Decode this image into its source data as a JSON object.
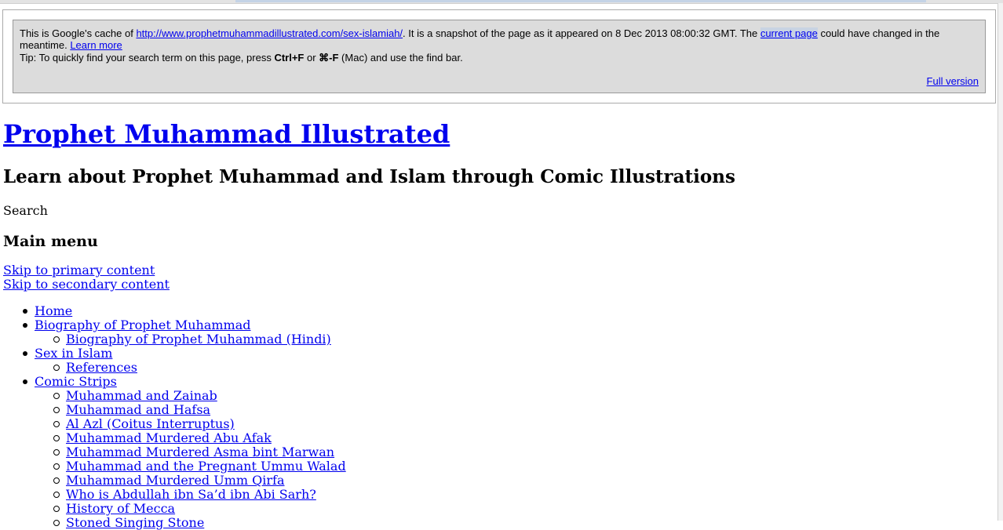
{
  "cache_notice": {
    "prefix": "This is Google's cache of ",
    "cached_url": "http://www.prophetmuhammadillustrated.com/sex-islamiah/",
    "snapshot_text": ". It is a snapshot of the page as it appeared on 8 Dec 2013 08:00:32 GMT. The ",
    "current_page_link": "current page",
    "suffix": " could have changed in the meantime. ",
    "learn_more_link": "Learn more",
    "tip_prefix": "Tip: To quickly find your search term on this page, press ",
    "tip_key1": "Ctrl+F",
    "tip_or": " or ",
    "tip_key2": "⌘-F",
    "tip_suffix": " (Mac) and use the find bar.",
    "full_version_link": "Full version"
  },
  "site": {
    "title": "Prophet Muhammad Illustrated",
    "description": "Learn about Prophet Muhammad and Islam through Comic Illustrations"
  },
  "search_label": "Search",
  "main_menu_heading": "Main menu",
  "skip_links": [
    "Skip to primary content",
    "Skip to secondary content"
  ],
  "menu": [
    {
      "label": "Home",
      "level": 1
    },
    {
      "label": "Biography of Prophet Muhammad",
      "level": 1
    },
    {
      "label": "Biography of Prophet Muhammad (Hindi)",
      "level": 2
    },
    {
      "label": "Sex in Islam",
      "level": 1
    },
    {
      "label": "References",
      "level": 2
    },
    {
      "label": "Comic Strips",
      "level": 1
    },
    {
      "label": "Muhammad and Zainab",
      "level": 2
    },
    {
      "label": "Muhammad and Hafsa",
      "level": 2
    },
    {
      "label": "Al Azl (Coitus Interruptus)",
      "level": 2
    },
    {
      "label": "Muhammad Murdered Abu Afak",
      "level": 2
    },
    {
      "label": "Muhammad Murdered Asma bint Marwan",
      "level": 2
    },
    {
      "label": "Muhammad and the Pregnant Ummu Walad",
      "level": 2
    },
    {
      "label": "Muhammad Murdered Umm Qirfa",
      "level": 2
    },
    {
      "label": "Who is Abdullah ibn Sa’d ibn Abi Sarh?",
      "level": 2
    },
    {
      "label": "History of Mecca",
      "level": 2
    },
    {
      "label": "Stoned Singing Stone",
      "level": 2
    }
  ]
}
